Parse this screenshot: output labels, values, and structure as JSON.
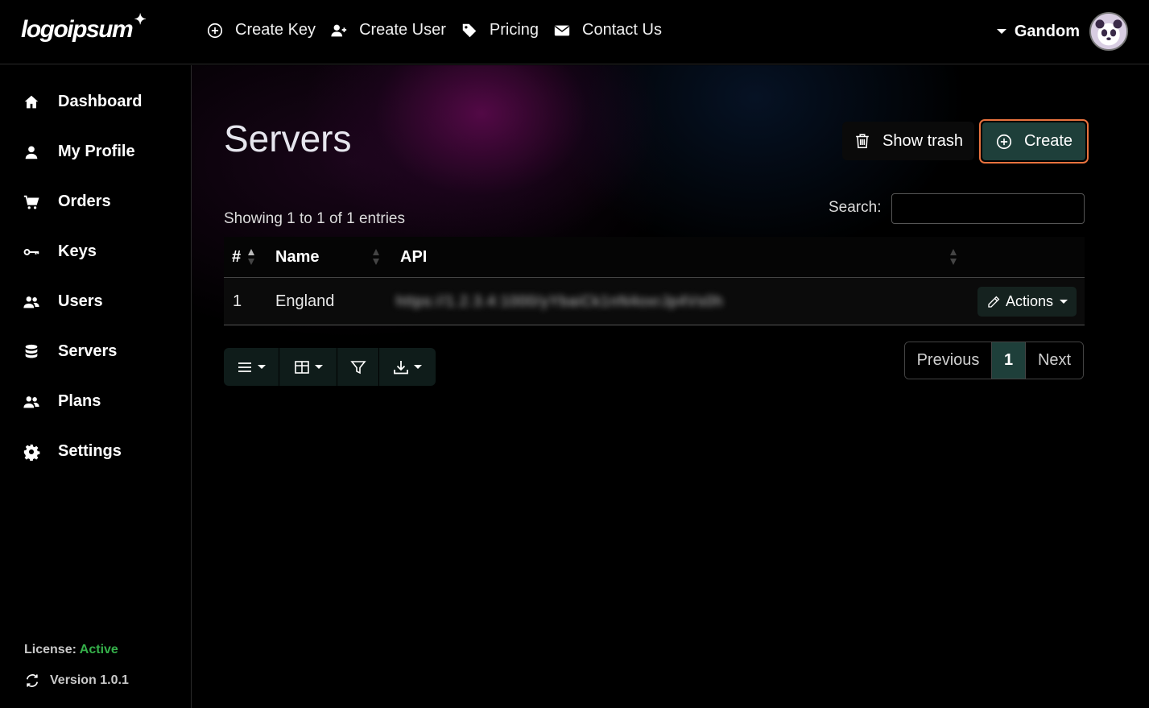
{
  "app": {
    "logo_text": "logoipsum",
    "logo_spark": "✦"
  },
  "topnav": {
    "items": [
      {
        "label": "Create Key",
        "icon": "plus-circle-icon"
      },
      {
        "label": "Create User",
        "icon": "user-plus-icon"
      },
      {
        "label": "Pricing",
        "icon": "tag-icon"
      },
      {
        "label": "Contact Us",
        "icon": "envelope-icon"
      }
    ],
    "username": "Gandom"
  },
  "sidebar": {
    "items": [
      {
        "label": "Dashboard",
        "icon": "home-icon"
      },
      {
        "label": "My Profile",
        "icon": "user-icon"
      },
      {
        "label": "Orders",
        "icon": "cart-icon"
      },
      {
        "label": "Keys",
        "icon": "key-icon"
      },
      {
        "label": "Users",
        "icon": "users-icon"
      },
      {
        "label": "Servers",
        "icon": "database-icon"
      },
      {
        "label": "Plans",
        "icon": "users-icon"
      },
      {
        "label": "Settings",
        "icon": "gear-icon"
      }
    ],
    "license_label": "License:",
    "license_status": "Active",
    "version": "Version 1.0.1"
  },
  "main": {
    "title": "Servers",
    "show_trash_label": "Show trash",
    "create_label": "Create",
    "info": "Showing 1 to 1 of 1 entries",
    "search_label": "Search:",
    "search_value": "",
    "table": {
      "columns": [
        "#",
        "Name",
        "API"
      ],
      "rows": [
        {
          "id": "1",
          "name": "England",
          "api": "https://1.2.3.4:1000/yYbaiCk1nN4oxrJp4Vs0h",
          "actions_label": "Actions"
        }
      ]
    },
    "pagination": {
      "previous": "Previous",
      "current": "1",
      "next": "Next"
    }
  },
  "colors": {
    "accent": "#1e3f3a",
    "highlight_border": "#e8723e",
    "license_active": "#35b04a"
  }
}
